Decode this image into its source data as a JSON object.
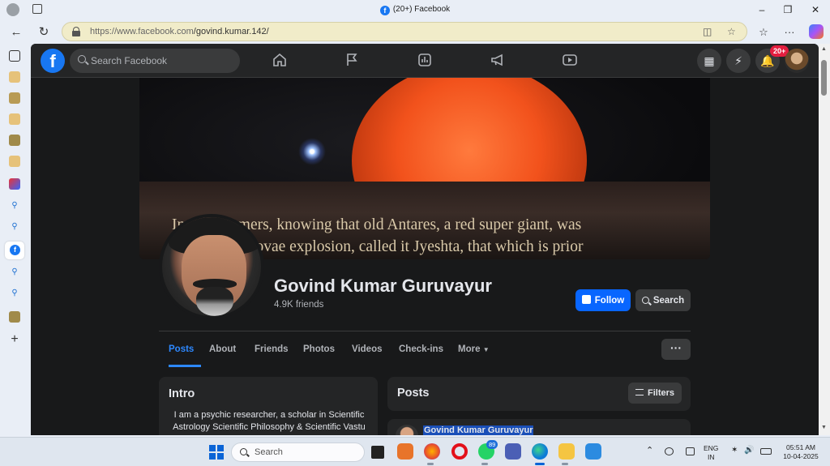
{
  "browser": {
    "tab_title": "(20+) Facebook",
    "url_host": "https://www.facebook.com",
    "url_path": "/govind.kumar.142/"
  },
  "fb": {
    "search_placeholder": "Search Facebook",
    "notification_badge": "20+",
    "colors": {
      "accent": "#0866ff",
      "bg": "#18191a",
      "card": "#242526"
    }
  },
  "cover": {
    "caption_line1": "In ... tronomers, knowing that old Antares, a red super giant, was",
    "caption_line2": "... rds Supernovae explosion, called it Jyeshta, that which is prior"
  },
  "profile": {
    "name": "Govind Kumar Guruvayur",
    "friends": "4.9K friends",
    "follow_label": "Follow",
    "search_label": "Search"
  },
  "tabs": [
    {
      "label": "Posts"
    },
    {
      "label": "About"
    },
    {
      "label": "Friends"
    },
    {
      "label": "Photos"
    },
    {
      "label": "Videos"
    },
    {
      "label": "Check-ins"
    },
    {
      "label": "More"
    }
  ],
  "more_dots": "···",
  "intro": {
    "title": "Intro",
    "text": "I am a psychic researcher, a scholar in Scientific Astrology Scientific Philosophy & Scientific Vastu"
  },
  "posts": {
    "title": "Posts",
    "filters_label": "Filters",
    "first_author": "Govind Kumar Guruvayur"
  },
  "taskbar": {
    "search_label": "Search",
    "whatsapp_badge": "89",
    "lang_line1": "ENG",
    "lang_line2": "IN",
    "time": "05:51 AM",
    "date": "10-04-2025"
  }
}
